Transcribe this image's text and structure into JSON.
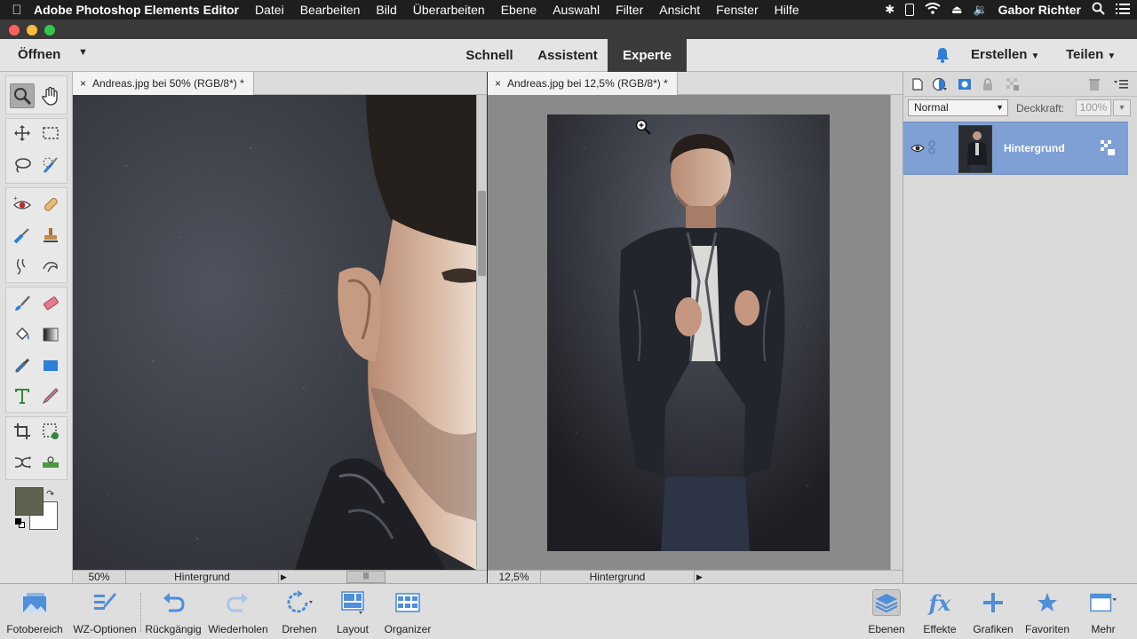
{
  "menubar": {
    "app_name": "Adobe Photoshop Elements Editor",
    "items": [
      "Datei",
      "Bearbeiten",
      "Bild",
      "Überarbeiten",
      "Ebene",
      "Auswahl",
      "Filter",
      "Ansicht",
      "Fenster",
      "Hilfe"
    ],
    "user": "Gabor Richter"
  },
  "modebar": {
    "open_label": "Öffnen",
    "tabs": [
      "Schnell",
      "Assistent",
      "Experte"
    ],
    "active_tab": "Experte",
    "create_label": "Erstellen",
    "share_label": "Teilen"
  },
  "documents": [
    {
      "tab_title": "Andreas.jpg bei 50% (RGB/8*) *",
      "zoom": "50%",
      "layer": "Hintergrund"
    },
    {
      "tab_title": "Andreas.jpg bei 12,5% (RGB/8*) *",
      "zoom": "12,5%",
      "layer": "Hintergrund"
    }
  ],
  "layers_panel": {
    "blend_mode": "Normal",
    "opacity_label": "Deckkraft:",
    "opacity_value": "100%",
    "layers": [
      {
        "name": "Hintergrund",
        "visible": true,
        "selected": true
      }
    ]
  },
  "bottombar": {
    "left_items": [
      "Fotobereich",
      "WZ-Optionen",
      "Rückgängig",
      "Wiederholen",
      "Drehen",
      "Layout",
      "Organizer"
    ],
    "right_items": [
      "Ebenen",
      "Effekte",
      "Grafiken",
      "Favoriten",
      "Mehr"
    ],
    "selected": "Ebenen"
  },
  "colors": {
    "foreground": "#5e6350",
    "background": "#ffffff",
    "accent": "#2e7fd8",
    "layer_selected": "#7ea0d4"
  },
  "icons": {
    "toolbox": [
      "zoom-tool-icon",
      "hand-tool-icon",
      "move-tool-icon",
      "marquee-tool-icon",
      "lasso-tool-icon",
      "quick-selection-icon",
      "red-eye-icon",
      "spot-healing-icon",
      "smart-brush-icon",
      "clone-stamp-icon",
      "blur-tool-icon",
      "smudge-tool-icon",
      "brush-tool-icon",
      "eraser-tool-icon",
      "paint-bucket-icon",
      "gradient-tool-icon",
      "eyedropper-icon",
      "rectangle-shape-icon",
      "type-tool-icon",
      "pencil-tool-icon",
      "crop-tool-icon",
      "recompose-tool-icon",
      "content-aware-move-icon",
      "straighten-tool-icon"
    ]
  }
}
